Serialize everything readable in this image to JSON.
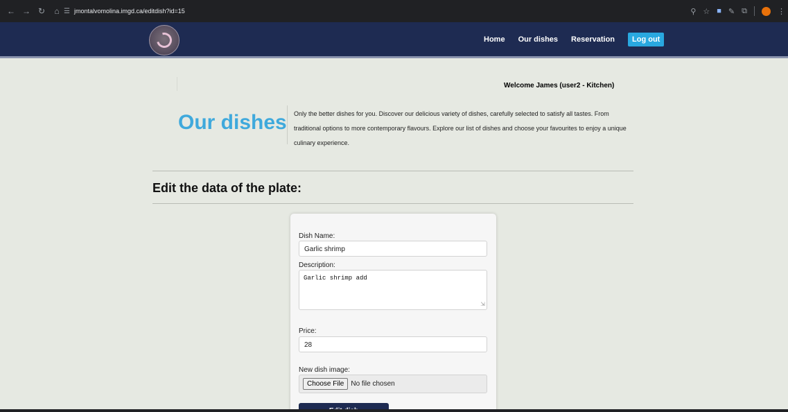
{
  "browser": {
    "url": "jmontalvomolina.imgd.ca/editdish?id=15",
    "nav_icons": [
      "back-icon",
      "forward-icon",
      "reload-icon",
      "home-icon"
    ],
    "toolbar_icons": [
      "key-icon",
      "star-icon",
      "extension-icon",
      "pen-icon",
      "extensions-puzzle-icon",
      "profile-icon",
      "menu-icon"
    ]
  },
  "navbar": {
    "menu": [
      {
        "label": "Home"
      },
      {
        "label": "Our dishes"
      },
      {
        "label": "Reservation"
      }
    ],
    "logout_label": "Log out",
    "logout_color": "#29a8e0",
    "background_color": "#1e2b52"
  },
  "welcome_text": "Welcome James (user2 - Kitchen)",
  "hero": {
    "title": "Our dishes",
    "title_color": "#3fa9dc",
    "text": "Only the better dishes for you. Discover our delicious variety of dishes, carefully selected to satisfy all tastes. From traditional options to more contemporary flavours. Explore our list of dishes and choose your favourites to enjoy a unique culinary experience."
  },
  "section_title": "Edit the data of the plate:",
  "form": {
    "dish_name_label": "Dish Name:",
    "dish_name_value": "Garlic shrimp",
    "description_label": "Description:",
    "description_value": "Garlic shrimp add",
    "price_label": "Price:",
    "price_value": "28",
    "image_label": "New dish image:",
    "choose_file_label": "Choose File",
    "no_file_text": "No file chosen",
    "submit_label": "Edit dish"
  }
}
